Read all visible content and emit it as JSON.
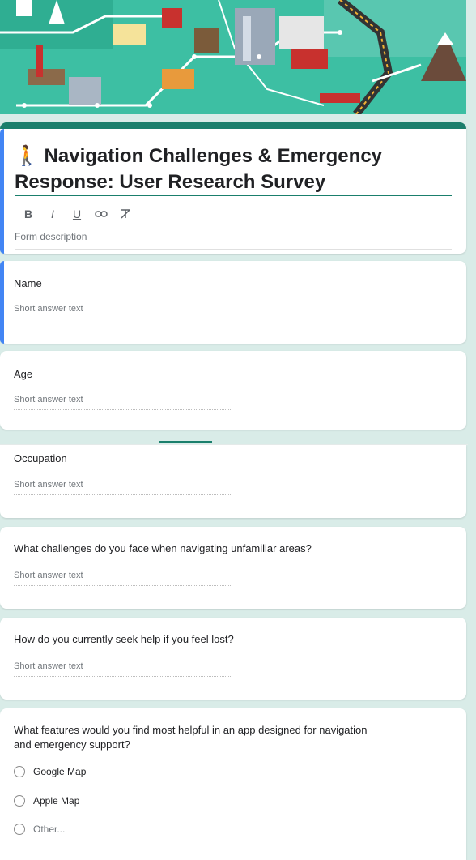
{
  "form": {
    "title": "🚶 Navigation Challenges & Emergency Response: User Research Survey",
    "description_placeholder": "Form description",
    "toolbar": {
      "bold": "B",
      "italic": "I",
      "underline": "U",
      "link": "🔗",
      "clear": "T̸"
    }
  },
  "questions": [
    {
      "label": "Name",
      "placeholder": "Short answer text"
    },
    {
      "label": "Age",
      "placeholder": "Short answer text"
    },
    {
      "label": "Occupation",
      "placeholder": "Short answer text"
    },
    {
      "label": "What challenges do you face when navigating unfamiliar areas?",
      "placeholder": "Short answer text"
    },
    {
      "label": "How do you currently seek help if you feel lost?",
      "placeholder": "Short answer text"
    },
    {
      "label": "What features would you find most helpful in an app designed for navigation and emergency support?",
      "options": [
        "Google Map",
        "Apple Map",
        "Other..."
      ]
    }
  ],
  "colors": {
    "theme": "#1a7f6c",
    "accent": "#4285f4",
    "background": "#d9ece8"
  }
}
